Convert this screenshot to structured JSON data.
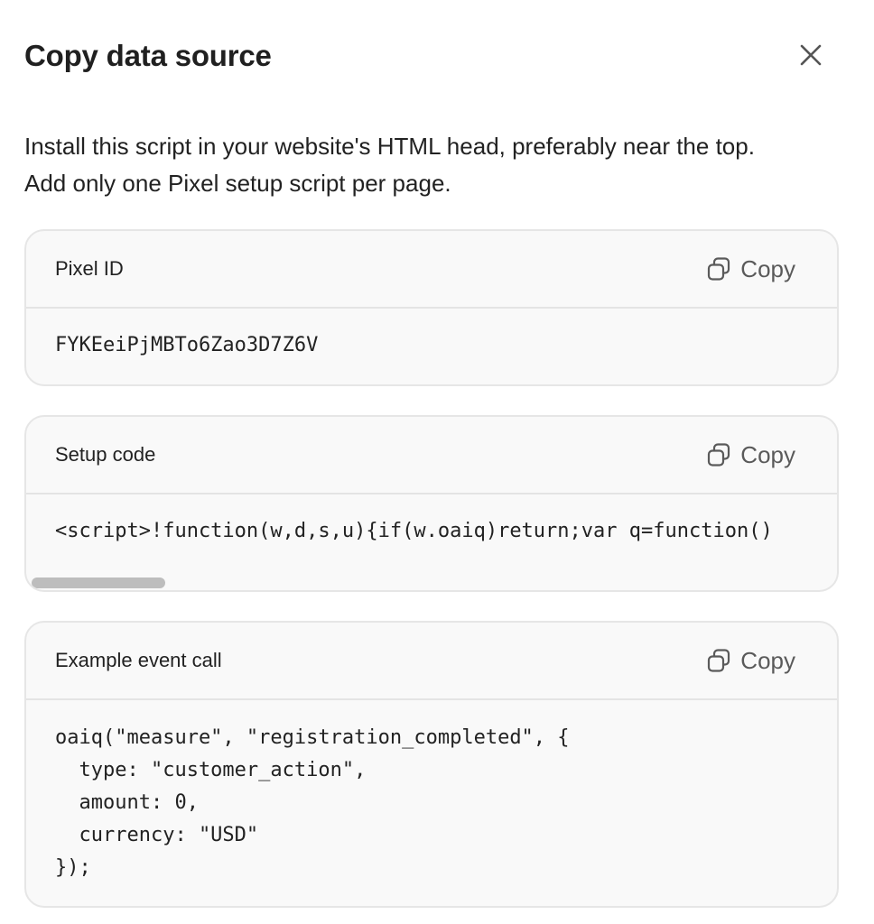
{
  "dialog": {
    "title": "Copy data source",
    "close_icon": "close-icon",
    "description_line1": "Install this script in your website's HTML head, preferably near the top.",
    "description_line2": "Add only one Pixel setup script per page."
  },
  "cards": {
    "pixel_id": {
      "label": "Pixel ID",
      "copy_label": "Copy",
      "value": "FYKEeiPjMBTo6Zao3D7Z6V"
    },
    "setup_code": {
      "label": "Setup code",
      "copy_label": "Copy",
      "value": "<script>!function(w,d,s,u){if(w.oaiq)return;var q=function()"
    },
    "example_event": {
      "label": "Example event call",
      "copy_label": "Copy",
      "code": "oaiq(\"measure\", \"registration_completed\", {\n  type: \"customer_action\",\n  amount: 0,\n  currency: \"USD\"\n});"
    }
  },
  "icons": {
    "copy": "copy-icon",
    "close": "close-icon"
  },
  "colors": {
    "card_background": "#f9f9f9",
    "card_border": "#e6e6e6",
    "scrollbar_thumb": "#bdbdbd",
    "copy_text": "#5a5a5a"
  }
}
